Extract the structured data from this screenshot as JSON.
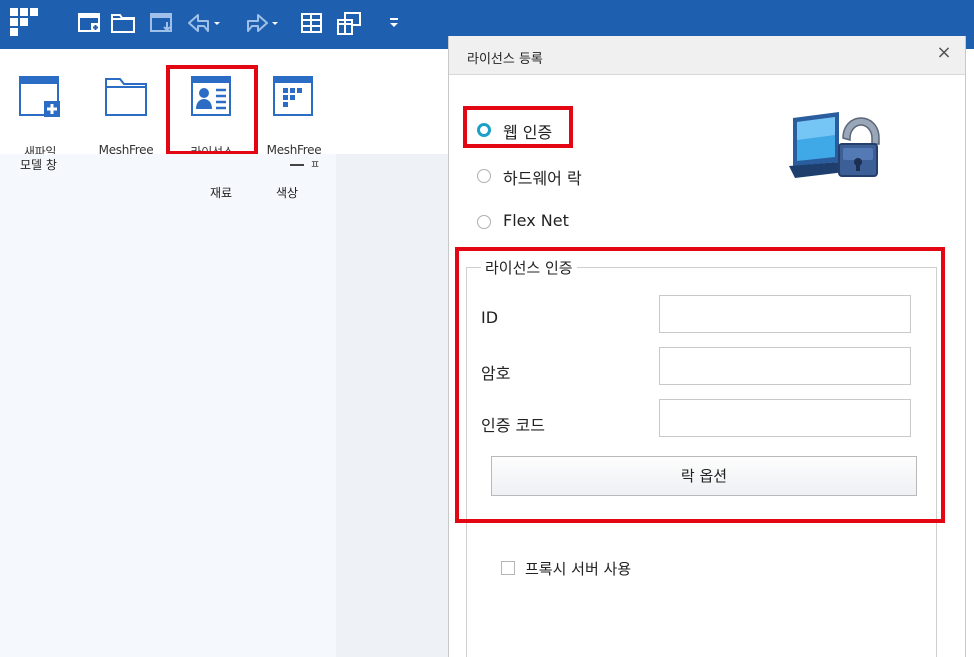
{
  "colors": {
    "title_bar": "#1f5fb0",
    "highlight": "#e30613",
    "radio_selected": "#1ba0c8",
    "pane_background": "#f5f8fc"
  },
  "quick_access": {
    "icons": [
      "app-grid-icon",
      "new-window-icon",
      "open-folder-icon",
      "import-icon",
      "undo-icon",
      "redo-icon",
      "table-grid-icon",
      "windows-cascade-icon",
      "customize-dropdown-icon"
    ]
  },
  "ribbon": {
    "buttons": [
      {
        "label": "새파일",
        "icon": "new-file-icon"
      },
      {
        "label": "MeshFree",
        "icon": "folder-icon"
      },
      {
        "label": "라이선스",
        "icon": "license-card-icon"
      },
      {
        "label": "MeshFree",
        "icon": "meshfree-app-icon"
      }
    ]
  },
  "left_pane": {
    "title": "모델 창",
    "pin_glyph": "ㅍ",
    "columns": [
      "재료",
      "색상"
    ]
  },
  "dialog": {
    "title": "라이선스 등록",
    "close_label": "×",
    "radio_options": [
      {
        "label": "웹 인증",
        "selected": true
      },
      {
        "label": "하드웨어 락",
        "selected": false
      },
      {
        "label": "Flex Net",
        "selected": false
      }
    ],
    "auth_group": {
      "legend": "라이선스 인증",
      "fields": [
        {
          "label": "ID",
          "value": ""
        },
        {
          "label": "암호",
          "value": ""
        },
        {
          "label": "인증 코드",
          "value": ""
        }
      ],
      "lock_option_button": "락 옵션"
    },
    "proxy_checkbox": {
      "label": "프록시 서버 사용",
      "checked": false
    }
  }
}
